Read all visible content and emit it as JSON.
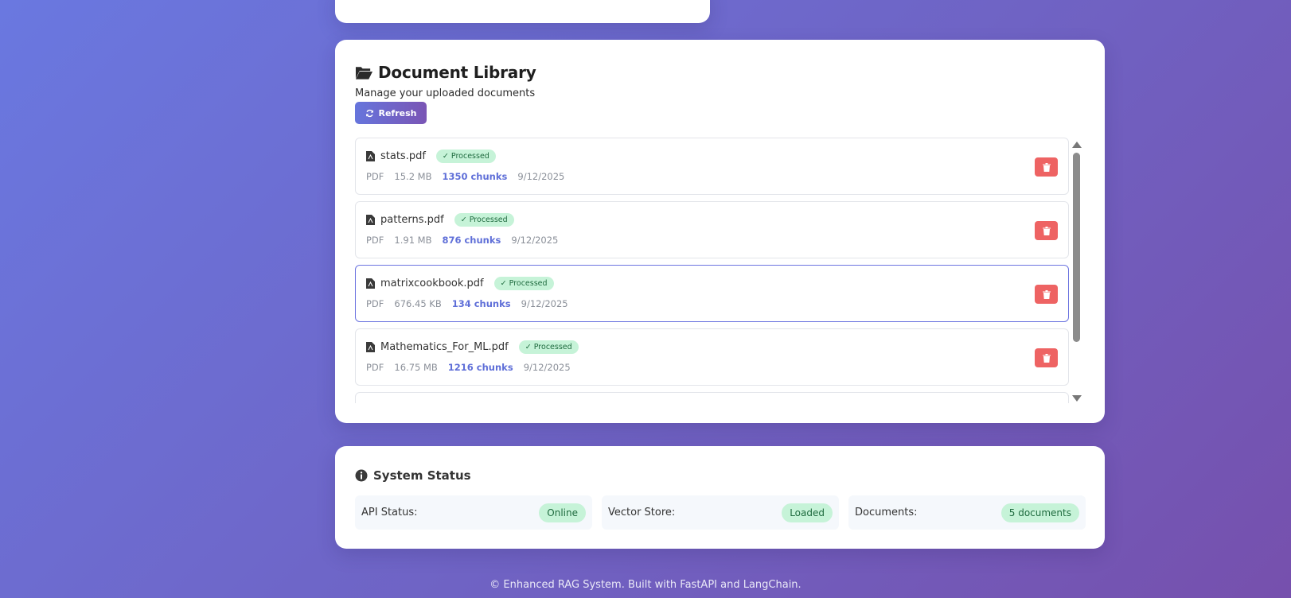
{
  "library": {
    "title": "Document Library",
    "subtitle": "Manage your uploaded documents",
    "refresh_label": "Refresh",
    "documents": [
      {
        "name": "stats.pdf",
        "status": "✓ Processed",
        "type": "PDF",
        "size": "15.2 MB",
        "chunks": "1350 chunks",
        "date": "9/12/2025"
      },
      {
        "name": "patterns.pdf",
        "status": "✓ Processed",
        "type": "PDF",
        "size": "1.91 MB",
        "chunks": "876 chunks",
        "date": "9/12/2025"
      },
      {
        "name": "matrixcookbook.pdf",
        "status": "✓ Processed",
        "type": "PDF",
        "size": "676.45 KB",
        "chunks": "134 chunks",
        "date": "9/12/2025",
        "selected": true
      },
      {
        "name": "Mathematics_For_ML.pdf",
        "status": "✓ Processed",
        "type": "PDF",
        "size": "16.75 MB",
        "chunks": "1216 chunks",
        "date": "9/12/2025"
      }
    ]
  },
  "status": {
    "title": "System Status",
    "items": [
      {
        "label": "API Status:",
        "value": "Online"
      },
      {
        "label": "Vector Store:",
        "value": "Loaded"
      },
      {
        "label": "Documents:",
        "value": "5 documents"
      }
    ]
  },
  "footer": {
    "text": "© Enhanced RAG System. Built with FastAPI and LangChain."
  },
  "colors": {
    "accent": "#6675dc",
    "success_bg": "#c6f3d8",
    "danger": "#ee6363"
  },
  "icons": {
    "library": "folder-open-icon",
    "refresh": "refresh-icon",
    "file": "file-pdf-icon",
    "delete": "trash-icon",
    "info": "info-circle-icon"
  }
}
